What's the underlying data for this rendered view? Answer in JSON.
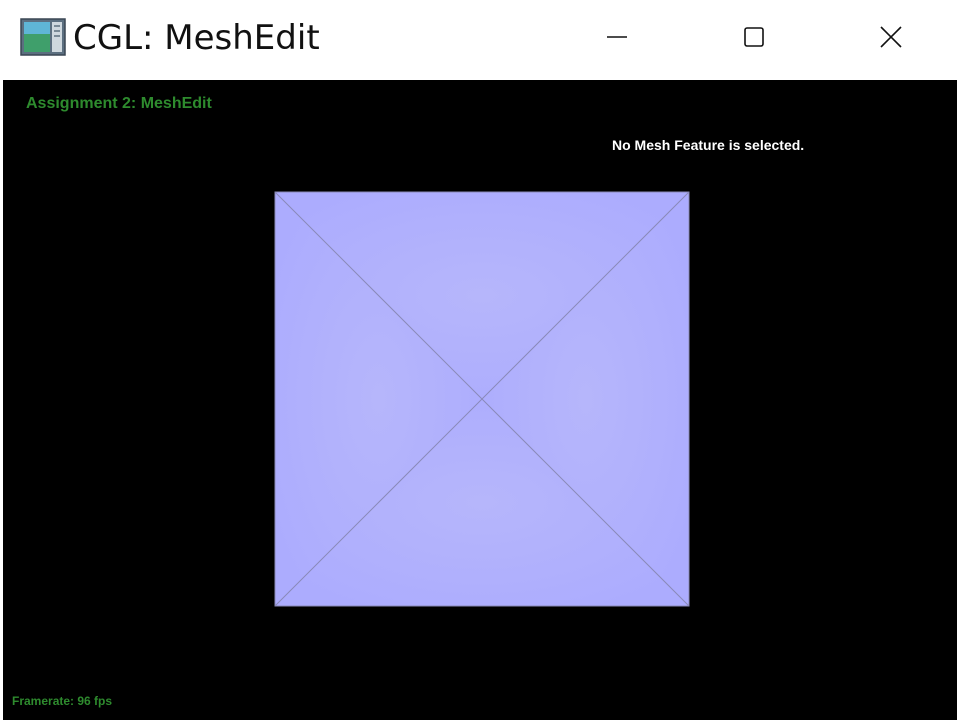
{
  "window": {
    "title": "CGL: MeshEdit",
    "app_icon": "app-window-icon",
    "controls": {
      "minimize_icon": "minimize-icon",
      "maximize_icon": "maximize-icon",
      "close_icon": "close-icon"
    }
  },
  "hud": {
    "title": "Assignment 2: MeshEdit",
    "status": "No Mesh Feature is selected.",
    "framerate": "Framerate: 96 fps"
  },
  "mesh": {
    "face_color": "#b1b1fd",
    "edge_color": "#8a8ab8",
    "vertices": 5,
    "faces": 4
  },
  "colors": {
    "hud_green": "#2e8b2e",
    "background": "#000000"
  }
}
